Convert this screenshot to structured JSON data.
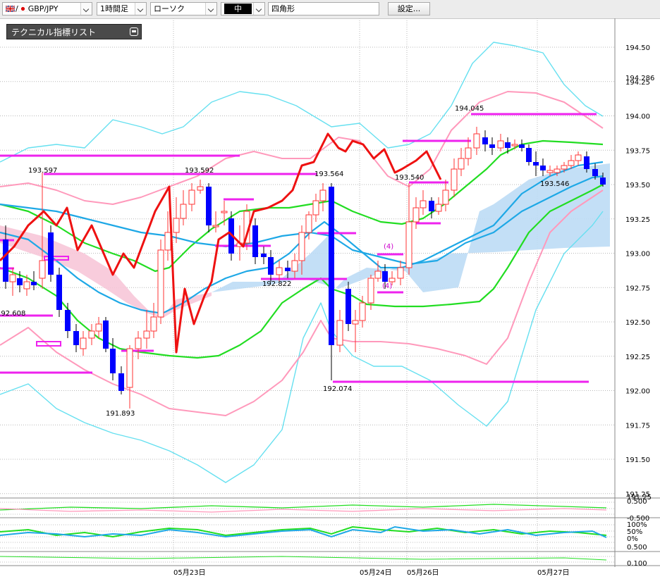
{
  "toolbar": {
    "symbol": "GBP/JPY",
    "timeframe": "1時間足",
    "chart_style": "ローソク",
    "line_width": "中",
    "shape_tool": "四角形",
    "settings_button": "設定..."
  },
  "indicator_panel": {
    "label": "テクニカル指標リスト"
  },
  "colors": {
    "bull_candle": "#ff3333",
    "bear_candle": "#0000ff",
    "bollinger_outer": "#66e0f0",
    "bollinger_inner": "#ff99bb",
    "ma_green": "#22dd22",
    "ma_blue": "#1ea8e6",
    "lagging_span": "#ee1111",
    "cloud_upper": "#bcdcf5",
    "cloud_lower": "#f7c6d8",
    "horizontal_lines": "#ee22ee"
  },
  "chart_data": {
    "type": "candlestick",
    "price_axis": {
      "ticks": [
        "194.50",
        "194.25",
        "194.00",
        "193.75",
        "193.50",
        "193.25",
        "193.00",
        "192.75",
        "192.50",
        "192.25",
        "192.00",
        "191.75",
        "191.50",
        "191.25"
      ],
      "range": [
        191.2,
        194.8
      ],
      "current_price_label": "194.286"
    },
    "time_axis": {
      "labels": [
        "05月23日",
        "05月24日",
        "05月26日",
        "05月27日"
      ]
    },
    "price_annotations": [
      "193.597",
      "193.592",
      "193.564",
      "193.540",
      "193.546",
      "194.045",
      "192.822",
      "192.608",
      "191.893",
      "192.074"
    ],
    "wave_labels": [
      "(4)",
      "(4)"
    ],
    "subpanel_1": {
      "ticks": [
        "0.500",
        "-0.500"
      ]
    },
    "subpanel_2": {
      "ticks": [
        "100%",
        "50%",
        "0%"
      ]
    },
    "subpanel_3": {
      "ticks": [
        "0.500",
        "0.100"
      ]
    }
  }
}
